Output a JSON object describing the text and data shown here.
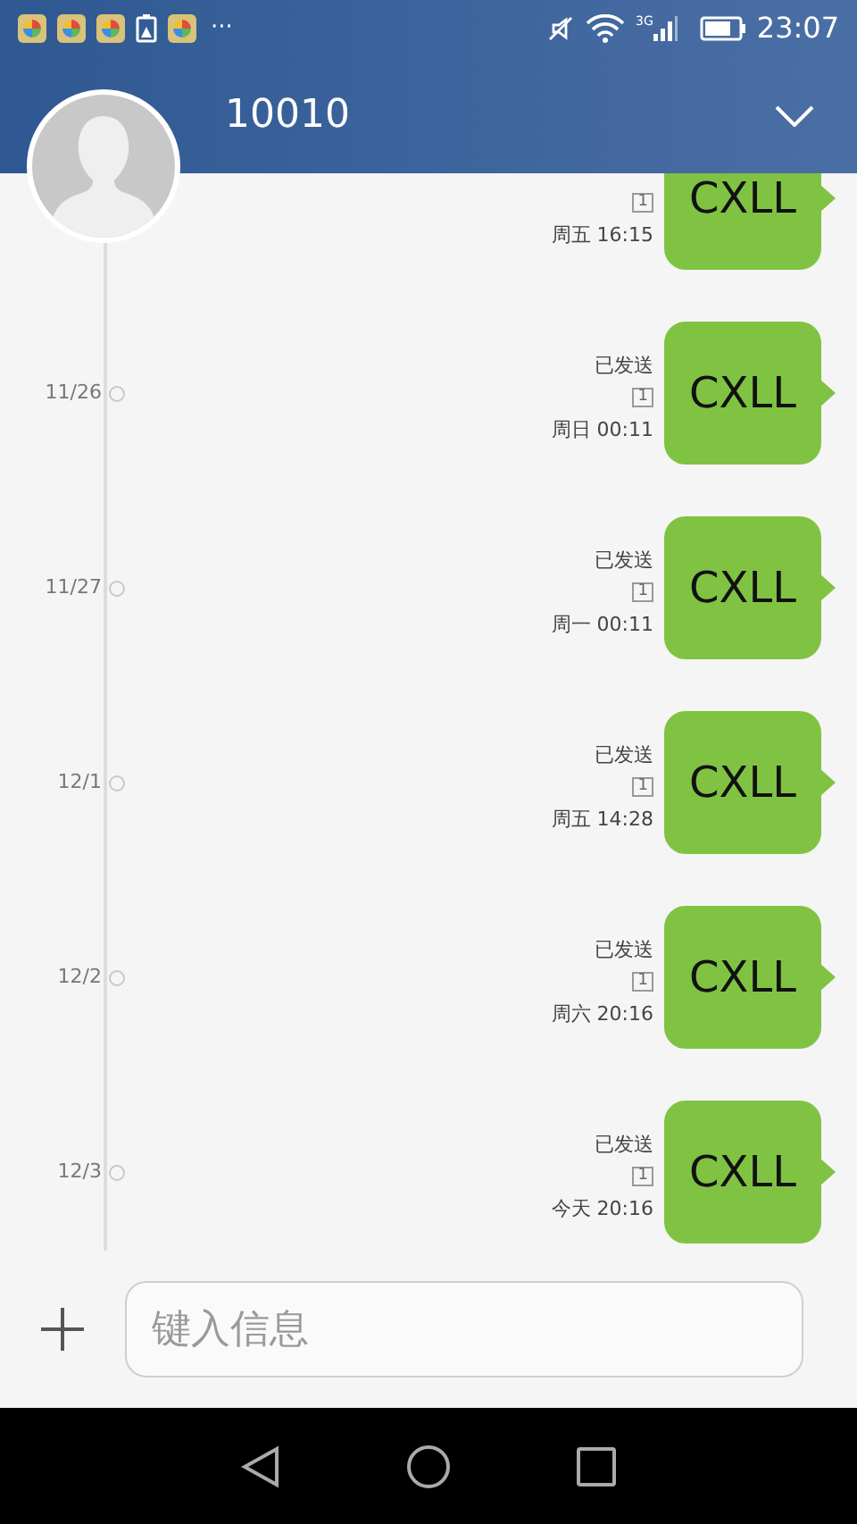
{
  "status_bar": {
    "more": "···",
    "network": "3G",
    "time": "23:07"
  },
  "header": {
    "title": "10010"
  },
  "messages": [
    {
      "sim": "1",
      "time": "周五 16:15",
      "text": "CXLL"
    },
    {
      "date": "11/26",
      "status": "已发送",
      "sim": "1",
      "time": "周日 00:11",
      "text": "CXLL"
    },
    {
      "date": "11/27",
      "status": "已发送",
      "sim": "1",
      "time": "周一 00:11",
      "text": "CXLL"
    },
    {
      "date": "12/1",
      "status": "已发送",
      "sim": "1",
      "time": "周五 14:28",
      "text": "CXLL"
    },
    {
      "date": "12/2",
      "status": "已发送",
      "sim": "1",
      "time": "周六 20:16",
      "text": "CXLL"
    },
    {
      "date": "12/3",
      "status": "已发送",
      "sim": "1",
      "time": "今天 20:16",
      "text": "CXLL"
    }
  ],
  "composer": {
    "placeholder": "键入信息"
  }
}
